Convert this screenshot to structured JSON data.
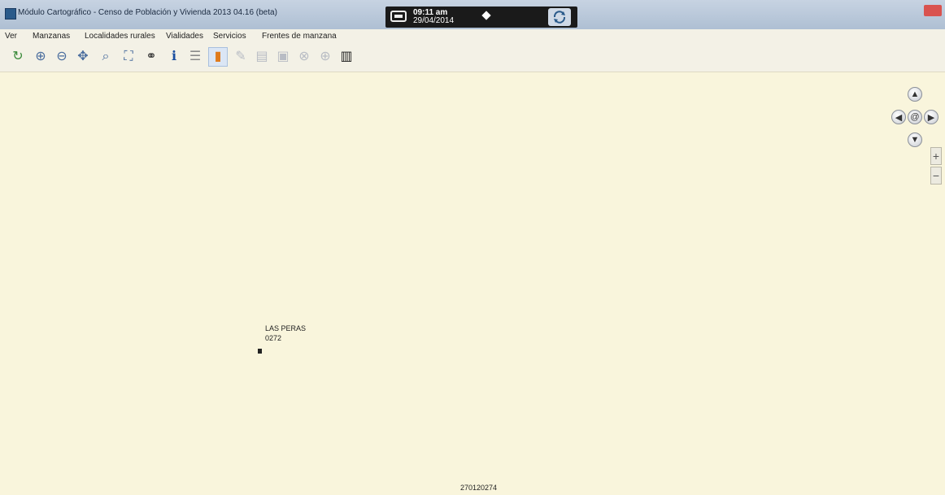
{
  "window": {
    "title": "Módulo Cartográfico - Censo de Población y Vivienda 2013 04.16 (beta)",
    "status": {
      "time": "09:11 am",
      "date": "29/04/2014"
    }
  },
  "menu": {
    "items": [
      "Ver",
      "Manzanas",
      "Localidades rurales",
      "Vialidades",
      "Servicios",
      "Frentes de manzana"
    ]
  },
  "toolbar": {
    "tools": [
      {
        "name": "refresh-icon",
        "glyph": "↻"
      },
      {
        "name": "zoom-in-icon",
        "glyph": "⊕"
      },
      {
        "name": "zoom-out-icon",
        "glyph": "⊖"
      },
      {
        "name": "pan-icon",
        "glyph": "✥"
      },
      {
        "name": "zoom-extent-icon",
        "glyph": "⌕"
      },
      {
        "name": "full-extent-icon",
        "glyph": "⛶"
      },
      {
        "name": "binoculars-icon",
        "glyph": "⚭"
      },
      {
        "name": "info-icon",
        "glyph": "ℹ"
      },
      {
        "name": "layers-icon",
        "glyph": "☰"
      },
      {
        "name": "locality-marker-icon",
        "glyph": "▮"
      },
      {
        "name": "edit-icon",
        "glyph": "✎"
      },
      {
        "name": "document-icon",
        "glyph": "▤"
      },
      {
        "name": "save-icon",
        "glyph": "▣"
      },
      {
        "name": "delete-icon",
        "glyph": "⊗"
      },
      {
        "name": "split-icon",
        "glyph": "⊕"
      },
      {
        "name": "barcode-icon",
        "glyph": "▥"
      }
    ]
  },
  "map": {
    "locality_name": "LAS PERAS",
    "locality_code": "0272",
    "area_code": "270120274"
  },
  "nav": {
    "up": "▲",
    "left": "◀",
    "center": "@",
    "right": "▶",
    "down": "▼",
    "zoom_in": "+",
    "zoom_out": "−"
  }
}
